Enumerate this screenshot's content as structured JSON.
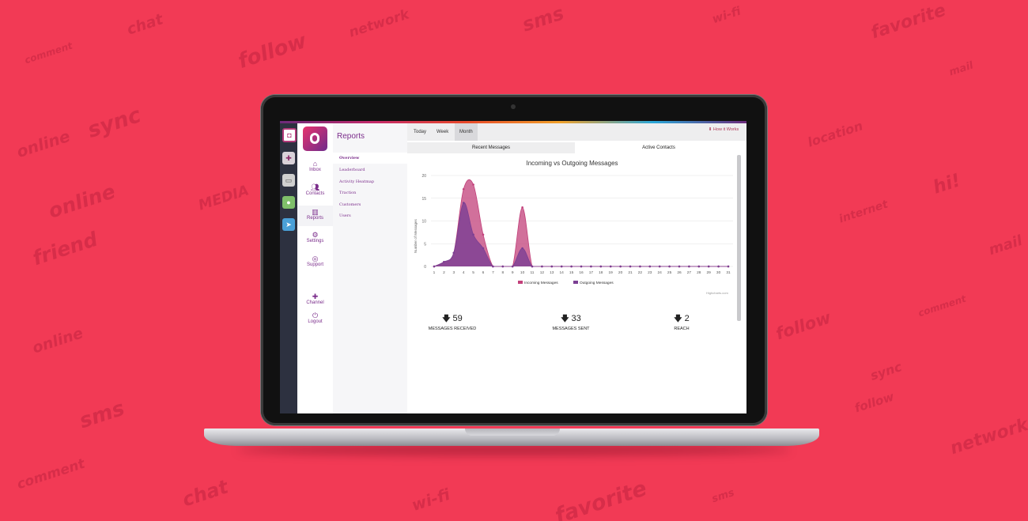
{
  "background_words": [
    "comment",
    "chat",
    "follow",
    "network",
    "sms",
    "wi-fi",
    "favorite",
    "mail",
    "online",
    "sync",
    "MEDIA",
    "friend",
    "location",
    "hi!",
    "internet",
    "follow",
    "comment",
    "online",
    "sms"
  ],
  "sidebar_rail": {
    "icons": [
      "app-logo-icon",
      "slack-icon",
      "chat-widget-icon",
      "wechat-icon",
      "telegram-icon"
    ]
  },
  "nav": {
    "items": [
      {
        "label": "Inbox",
        "icon": "inbox-icon"
      },
      {
        "label": "Contacts",
        "icon": "contacts-icon"
      },
      {
        "label": "Reports",
        "icon": "reports-icon"
      },
      {
        "label": "Settings",
        "icon": "settings-icon"
      },
      {
        "label": "Support",
        "icon": "support-icon"
      },
      {
        "label": "Channel",
        "icon": "plus-icon"
      },
      {
        "label": "Logout",
        "icon": "power-icon"
      }
    ]
  },
  "reports_menu": {
    "title": "Reports",
    "items": [
      "Overview",
      "Leaderboard",
      "Activity Heatmap",
      "Traction",
      "Customers",
      "Users"
    ]
  },
  "toolbar": {
    "tabs": [
      "Today",
      "Week",
      "Month"
    ],
    "active_tab": "Month",
    "how_it_works": "How it Works"
  },
  "subtabs": [
    "Recent Messages",
    "Active Contacts"
  ],
  "colors": {
    "accent": "#7b2d8b",
    "incoming": "#c2407a",
    "outgoing": "#7b3f93",
    "background": "#f23a55"
  },
  "chart_data": {
    "type": "area",
    "title": "Incoming vs Outgoing Messages",
    "ylabel": "Number of Messages",
    "xlabel": "",
    "ylim": [
      0,
      20
    ],
    "yticks": [
      0,
      5,
      10,
      15,
      20
    ],
    "categories": [
      1,
      2,
      3,
      4,
      5,
      6,
      7,
      8,
      9,
      10,
      11,
      12,
      13,
      14,
      15,
      16,
      17,
      18,
      19,
      20,
      21,
      22,
      23,
      24,
      25,
      26,
      27,
      28,
      29,
      30,
      31
    ],
    "series": [
      {
        "name": "Incoming Messages",
        "values": [
          0,
          1,
          3,
          17,
          18,
          7,
          0,
          0,
          0,
          13,
          0,
          0,
          0,
          0,
          0,
          0,
          0,
          0,
          0,
          0,
          0,
          0,
          0,
          0,
          0,
          0,
          0,
          0,
          0,
          0,
          0
        ]
      },
      {
        "name": "Outgoing Messages",
        "values": [
          0,
          1,
          3,
          14,
          7,
          4,
          0,
          0,
          0,
          4,
          0,
          0,
          0,
          0,
          0,
          0,
          0,
          0,
          0,
          0,
          0,
          0,
          0,
          0,
          0,
          0,
          0,
          0,
          0,
          0,
          0
        ]
      }
    ],
    "credits": "Highcharts.com",
    "legend": "bottom-center"
  },
  "stats": [
    {
      "value": "59",
      "label": "MESSAGES RECEIVED"
    },
    {
      "value": "33",
      "label": "MESSAGES SENT"
    },
    {
      "value": "2",
      "label": "REACH"
    }
  ]
}
